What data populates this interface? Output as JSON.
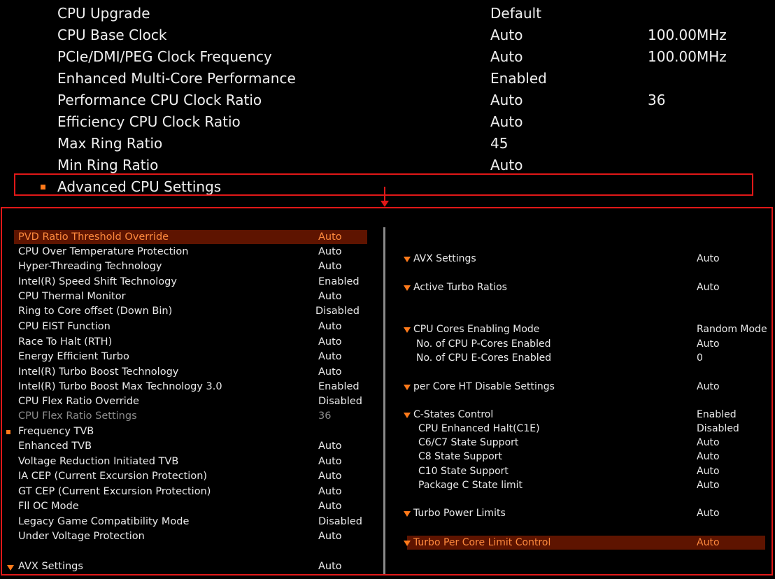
{
  "top_settings": [
    {
      "label": "CPU Upgrade",
      "value": "Default",
      "extra": ""
    },
    {
      "label": "CPU Base Clock",
      "value": "Auto",
      "extra": "100.00MHz"
    },
    {
      "label": "PCIe/DMI/PEG Clock Frequency",
      "value": "Auto",
      "extra": "100.00MHz"
    },
    {
      "label": "Enhanced Multi-Core Performance",
      "value": "Enabled",
      "extra": ""
    },
    {
      "label": "Performance CPU Clock Ratio",
      "value": "Auto",
      "extra": "36"
    },
    {
      "label": "Efficiency CPU Clock Ratio",
      "value": "Auto",
      "extra": ""
    },
    {
      "label": "Max Ring Ratio",
      "value": "45",
      "extra": ""
    },
    {
      "label": "Min Ring Ratio",
      "value": "Auto",
      "extra": ""
    },
    {
      "label": "Advanced CPU Settings",
      "value": "",
      "extra": ""
    }
  ],
  "left_panel": [
    {
      "label": "PVD Ratio Threshold Override",
      "value": "Auto"
    },
    {
      "label": "CPU Over Temperature Protection",
      "value": "Auto"
    },
    {
      "label": "Hyper-Threading Technology",
      "value": "Auto"
    },
    {
      "label": "Intel(R) Speed Shift Technology",
      "value": "Enabled"
    },
    {
      "label": "CPU Thermal Monitor",
      "value": "Auto"
    },
    {
      "label": "Ring to Core offset (Down Bin)",
      "value": "Disabled"
    },
    {
      "label": "CPU EIST Function",
      "value": "Auto"
    },
    {
      "label": "Race To Halt (RTH)",
      "value": "Auto"
    },
    {
      "label": "Energy Efficient Turbo",
      "value": "Auto"
    },
    {
      "label": "Intel(R) Turbo Boost Technology",
      "value": "Auto"
    },
    {
      "label": "Intel(R) Turbo Boost Max Technology 3.0",
      "value": "Enabled"
    },
    {
      "label": "CPU Flex Ratio Override",
      "value": "Disabled"
    },
    {
      "label": "CPU Flex Ratio Settings",
      "value": "36"
    },
    {
      "label": "Frequency TVB",
      "value": ""
    },
    {
      "label": "Enhanced TVB",
      "value": "Auto"
    },
    {
      "label": "Voltage Reduction Initiated TVB",
      "value": "Auto"
    },
    {
      "label": "IA CEP (Current Excursion Protection)",
      "value": "Auto"
    },
    {
      "label": "GT CEP (Current Excursion Protection)",
      "value": "Auto"
    },
    {
      "label": "Fll OC Mode",
      "value": "Auto"
    },
    {
      "label": "Legacy Game Compatibility Mode",
      "value": "Disabled"
    },
    {
      "label": "Under Voltage Protection",
      "value": "Auto"
    },
    {
      "label": "AVX Settings",
      "value": "Auto"
    }
  ],
  "right_panel": [
    {
      "label": "AVX Settings",
      "value": "Auto"
    },
    {
      "label": "Active Turbo Ratios",
      "value": "Auto"
    },
    {
      "label": "CPU Cores Enabling Mode",
      "value": "Random Mode"
    },
    {
      "label": "No. of CPU P-Cores Enabled",
      "value": "Auto"
    },
    {
      "label": "No. of CPU E-Cores Enabled",
      "value": "0"
    },
    {
      "label": "per Core HT Disable Settings",
      "value": "Auto"
    },
    {
      "label": "C-States Control",
      "value": "Enabled"
    },
    {
      "label": "CPU Enhanced Halt(C1E)",
      "value": "Disabled"
    },
    {
      "label": "C6/C7 State Support",
      "value": "Auto"
    },
    {
      "label": "C8 State Support",
      "value": "Auto"
    },
    {
      "label": "C10 State Support",
      "value": "Auto"
    },
    {
      "label": "Package C State limit",
      "value": "Auto"
    },
    {
      "label": "Turbo Power Limits",
      "value": "Auto"
    },
    {
      "label": "Turbo Per Core Limit Control",
      "value": "Auto"
    }
  ],
  "colors": {
    "accent": "#ff7a1a",
    "highlight_bg": "#5e1400",
    "annotation_red": "#e01818"
  }
}
